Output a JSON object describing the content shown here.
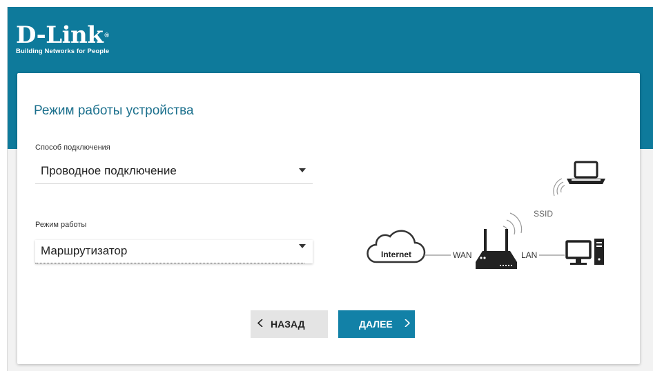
{
  "brand": {
    "logo": "D-Link",
    "tagline": "Building Networks for People"
  },
  "page": {
    "title": "Режим работы устройства"
  },
  "connection": {
    "label": "Способ подключения",
    "value": "Проводное подключение"
  },
  "mode": {
    "label": "Режим работы",
    "value": "Маршрутизатор"
  },
  "buttons": {
    "back": "НАЗАД",
    "next": "ДАЛЕЕ"
  },
  "diagram": {
    "internet": "Internet",
    "wan": "WAN",
    "lan": "LAN",
    "ssid": "SSID"
  },
  "colors": {
    "header": "#0e7a9b",
    "accent": "#1281a7",
    "title": "#1a6f8c"
  }
}
